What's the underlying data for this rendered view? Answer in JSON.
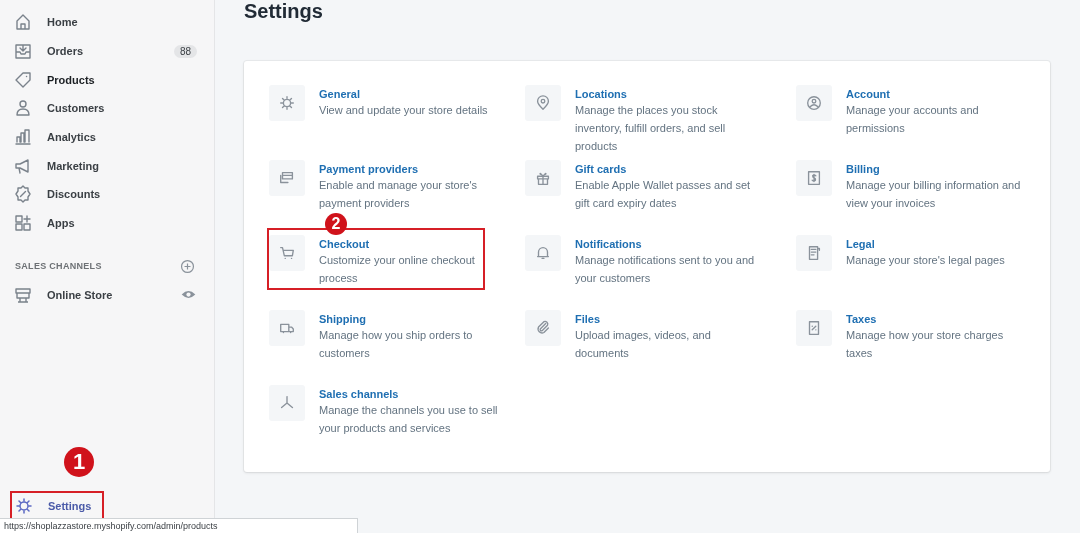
{
  "sidebar": {
    "items": [
      {
        "label": "Home",
        "selected": false,
        "hovered": false
      },
      {
        "label": "Orders",
        "badge": "88",
        "selected": false,
        "hovered": false
      },
      {
        "label": "Products",
        "selected": false,
        "hovered": true
      },
      {
        "label": "Customers",
        "selected": false,
        "hovered": false
      },
      {
        "label": "Analytics",
        "selected": false,
        "hovered": false
      },
      {
        "label": "Marketing",
        "selected": false,
        "hovered": false
      },
      {
        "label": "Discounts",
        "selected": false,
        "hovered": false
      },
      {
        "label": "Apps",
        "selected": false,
        "hovered": false
      }
    ],
    "section_title": "SALES CHANNELS",
    "channels": [
      {
        "label": "Online Store"
      }
    ],
    "settings": {
      "label": "Settings",
      "selected": true,
      "highlighted": true,
      "marker": "1"
    }
  },
  "page": {
    "title": "Settings"
  },
  "settings_items": [
    {
      "title": "General",
      "description": "View and update your store details",
      "highlighted": false
    },
    {
      "title": "Locations",
      "description": "Manage the places you stock inventory, fulfill orders, and sell products",
      "highlighted": false
    },
    {
      "title": "Account",
      "description": "Manage your accounts and permissions",
      "highlighted": false
    },
    {
      "title": "Payment providers",
      "description": "Enable and manage your store's payment providers",
      "highlighted": false
    },
    {
      "title": "Gift cards",
      "description": "Enable Apple Wallet passes and set gift card expiry dates",
      "highlighted": false
    },
    {
      "title": "Billing",
      "description": "Manage your billing information and view your invoices",
      "highlighted": false
    },
    {
      "title": "Checkout",
      "description": "Customize your online checkout process",
      "highlighted": true,
      "marker": "2"
    },
    {
      "title": "Notifications",
      "description": "Manage notifications sent to you and your customers",
      "highlighted": false
    },
    {
      "title": "Legal",
      "description": "Manage your store's legal pages",
      "highlighted": false
    },
    {
      "title": "Shipping",
      "description": "Manage how you ship orders to customers",
      "highlighted": false
    },
    {
      "title": "Files",
      "description": "Upload images, videos, and documents",
      "highlighted": false
    },
    {
      "title": "Taxes",
      "description": "Manage how your store charges taxes",
      "highlighted": false
    },
    {
      "title": "Sales channels",
      "description": "Manage the channels you use to sell your products and services",
      "highlighted": false
    }
  ],
  "status_bar": {
    "url": "https://shoplazzastore.myshopify.com/admin/products"
  }
}
